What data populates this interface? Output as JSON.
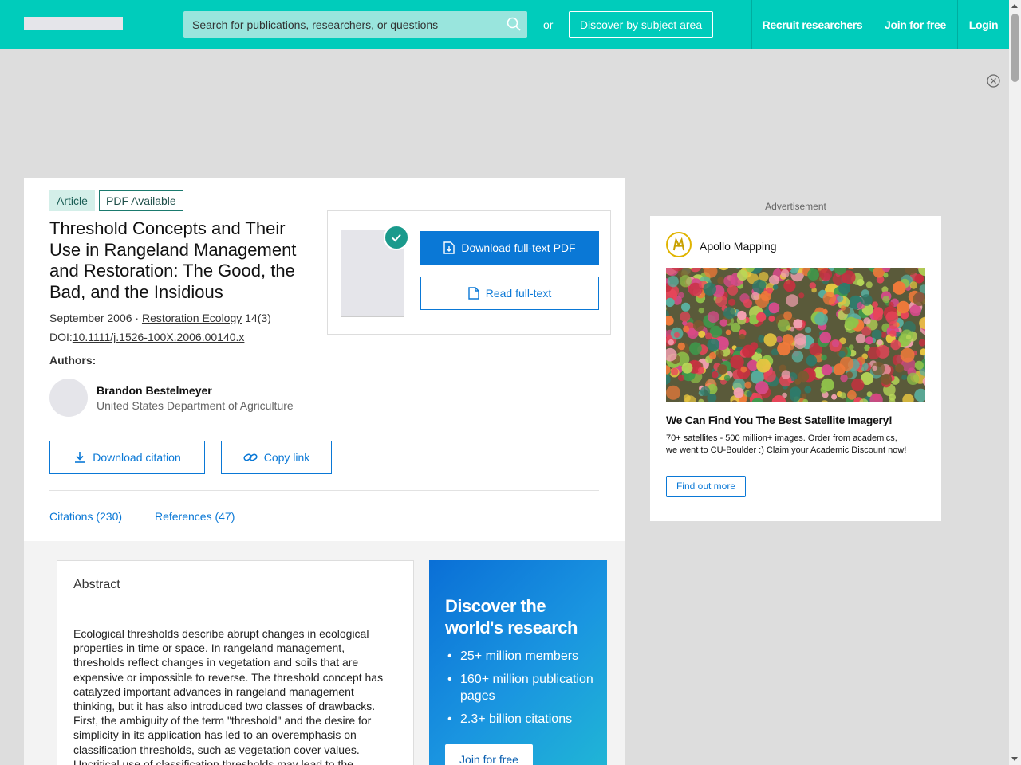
{
  "header": {
    "search_placeholder": "Search for publications, researchers, or questions",
    "or_label": "or",
    "discover_label": "Discover by subject area",
    "nav": [
      {
        "label": "Recruit researchers"
      },
      {
        "label": "Join for free"
      },
      {
        "label": "Login"
      }
    ]
  },
  "publication": {
    "type_badge": "Article",
    "pdf_badge": "PDF Available",
    "title": "Threshold Concepts and Their Use in Rangeland Management and Restoration: The Good, the Bad, and the Insidious",
    "date": "September 2006 ·",
    "journal": "Restoration Ecology",
    "volume": "14(3)",
    "doi_prefix": "DOI:",
    "doi": "10.1111/j.1526-100X.2006.00140.x",
    "authors_label": "Authors:",
    "author": {
      "name": "Brandon Bestelmeyer",
      "affiliation": "United States Department of Agriculture"
    },
    "download_pdf_label": "Download full-text PDF",
    "read_fulltext_label": "Read full-text",
    "download_citation_label": "Download citation",
    "copy_link_label": "Copy link",
    "tabs": [
      {
        "label": "Citations (230)"
      },
      {
        "label": "References (47)"
      }
    ]
  },
  "abstract": {
    "heading": "Abstract",
    "text": "Ecological thresholds describe abrupt changes in ecological properties in time or space. In rangeland management, thresholds reflect changes in vegetation and soils that are expensive or impossible to reverse. The threshold concept has catalyzed important advances in rangeland management thinking, but it has also introduced two classes of drawbacks. First, the ambiguity of the term \"threshold\" and the desire for simplicity in its application has led to an overemphasis on classification thresholds, such as vegetation cover values. Uncritical use of classification thresholds may lead to the"
  },
  "promo": {
    "title": "Discover the world's research",
    "items": [
      "25+ million members",
      "160+ million publication pages",
      "2.3+ billion citations"
    ],
    "button": "Join for free"
  },
  "ad": {
    "label": "Advertisement",
    "brand": "Apollo Mapping",
    "headline": "We Can Find You The Best Satellite Imagery!",
    "body": "70+ satellites - 500 million+ images. Order from academics, we went to CU-Boulder :) Claim your Academic Discount now!",
    "button": "Find out more"
  },
  "colors": {
    "brand": "#00ccbb",
    "link": "#0a78d6",
    "teal_badge": "#1a7a6e"
  }
}
